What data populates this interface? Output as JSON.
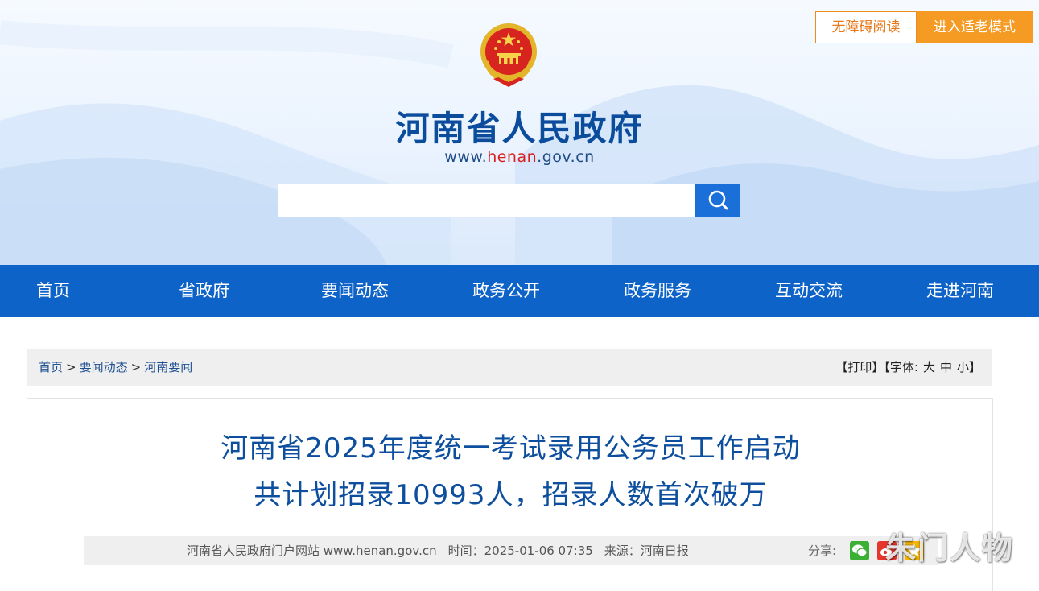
{
  "accessibility": {
    "barrier_free_label": "无障碍阅读",
    "elder_mode_label": "进入适老模式"
  },
  "site": {
    "title": "河南省人民政府",
    "url_prefix": "www.",
    "url_highlight": "henan",
    "url_suffix": ".gov.cn"
  },
  "search": {
    "placeholder": "",
    "value": ""
  },
  "nav": {
    "items": [
      "首页",
      "省政府",
      "要闻动态",
      "政务公开",
      "政务服务",
      "互动交流",
      "走进河南"
    ]
  },
  "breadcrumb": {
    "items": [
      "首页",
      "要闻动态",
      "河南要闻"
    ],
    "separator": ">"
  },
  "tools": {
    "print": "【打印】",
    "font_label": "【字体:",
    "font_large": "大",
    "font_medium": "中",
    "font_small": "小",
    "font_close": "】"
  },
  "article": {
    "headline_line1": "河南省2025年度统一考试录用公务员工作启动",
    "headline_line2": "共计划招录10993人，招录人数首次破万",
    "publisher": "河南省人民政府门户网站 www.henan.gov.cn",
    "time": "时间：2025-01-06 07:35",
    "source": "来源：河南日报",
    "share_label": "分享:"
  },
  "watermark": "朱门人物",
  "colors": {
    "nav_blue": "#0e63c8",
    "title_blue": "#0b4c9c",
    "accent_orange": "#f59a23",
    "url_red": "#d81e1e"
  },
  "icons": [
    "national-emblem-icon",
    "search-icon",
    "wechat-icon",
    "weibo-icon",
    "qzone-icon"
  ]
}
